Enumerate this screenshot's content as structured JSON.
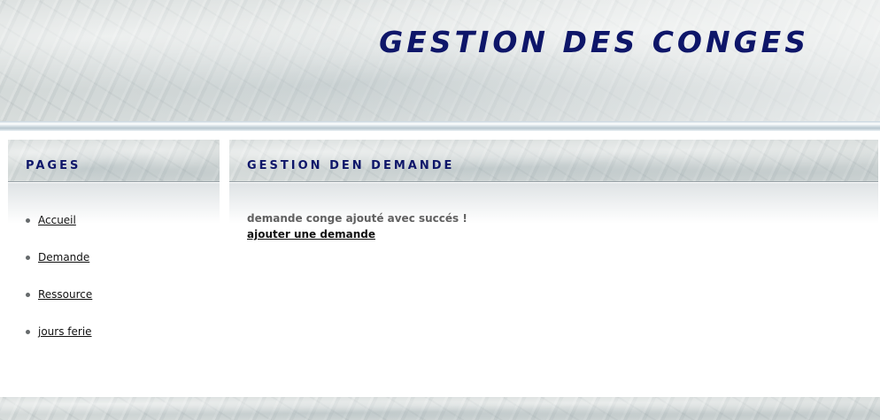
{
  "header": {
    "title": "GESTION DES CONGES"
  },
  "sidebar": {
    "heading": "PAGES",
    "items": [
      {
        "label": "Accueil"
      },
      {
        "label": "Demande"
      },
      {
        "label": "Ressource"
      },
      {
        "label": "jours ferie"
      }
    ]
  },
  "main": {
    "heading": "GESTION DEN DEMANDE",
    "message": "demande conge ajouté avec succés !",
    "link_label": "ajouter une demande"
  },
  "colors": {
    "title": "#0e1669",
    "heading": "#0e1669",
    "message": "#606060",
    "link": "#111111"
  }
}
